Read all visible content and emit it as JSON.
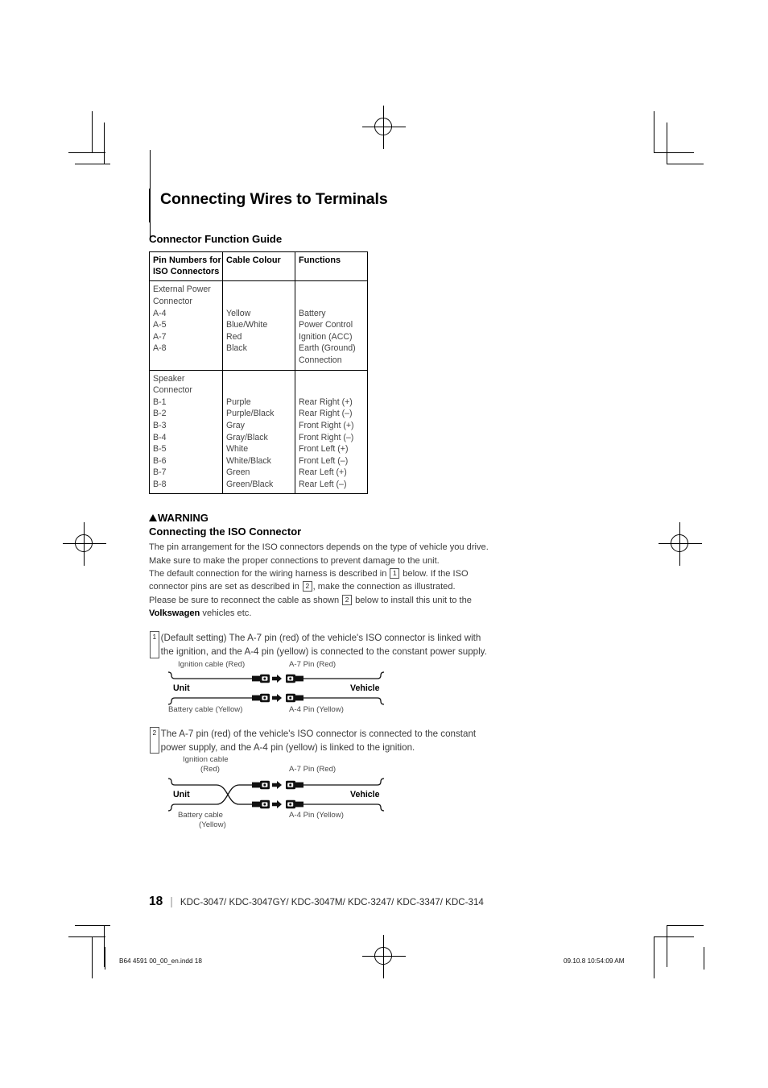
{
  "document": {
    "title": "Connecting Wires to Terminals",
    "section_title": "Connector Function Guide"
  },
  "table": {
    "headers": [
      "Pin Numbers for ISO Connectors",
      "Cable Colour",
      "Functions"
    ],
    "header_lines": [
      [
        "Pin Numbers for",
        "ISO Connectors"
      ],
      [
        "Cable Colour"
      ],
      [
        "Functions"
      ]
    ],
    "groups": [
      {
        "name": "External Power Connector",
        "pins_lines": [
          "External Power",
          "Connector",
          "A-4",
          "A-5",
          "A-7",
          "A-8"
        ],
        "colour_lines": [
          "",
          "",
          "Yellow",
          "Blue/White",
          "Red",
          "Black"
        ],
        "function_lines": [
          "",
          "",
          "Battery",
          "Power Control",
          "Ignition (ACC)",
          "Earth (Ground)",
          "Connection"
        ]
      },
      {
        "name": "Speaker Connector",
        "pins_lines": [
          "Speaker",
          "Connector",
          "B-1",
          "B-2",
          "B-3",
          "B-4",
          "B-5",
          "B-6",
          "B-7",
          "B-8"
        ],
        "colour_lines": [
          "",
          "",
          "Purple",
          "Purple/Black",
          "Gray",
          "Gray/Black",
          "White",
          "White/Black",
          "Green",
          "Green/Black"
        ],
        "function_lines": [
          "",
          "",
          "Rear Right (+)",
          "Rear Right (–)",
          "Front Right (+)",
          "Front Right (–)",
          "Front Left (+)",
          "Front Left (–)",
          "Rear Left (+)",
          "Rear Left (–)"
        ]
      }
    ]
  },
  "warning": {
    "label": "WARNING",
    "subtitle": "Connecting the ISO Connector",
    "paragraph1_part1": "The pin arrangement for the ISO connectors depends on the type of vehicle you drive. Make sure to make the proper connections to prevent damage to the unit.",
    "paragraph2_a": "The default connection for the wiring harness is described in",
    "paragraph2_box1": "1",
    "paragraph2_b": "below. If the ISO connector pins are set as described in",
    "paragraph2_box2": "2",
    "paragraph2_c": ", make the connection as illustrated.",
    "paragraph3_a": "Please be sure to reconnect the cable as shown",
    "paragraph3_box": "2",
    "paragraph3_b": "below to install this unit to the",
    "paragraph3_brand": "Volkswagen",
    "paragraph3_c": "vehicles etc."
  },
  "steps": [
    {
      "number": "1",
      "text": "(Default setting) The A-7 pin (red) of the vehicle's ISO connector is linked with the ignition, and the A-4 pin (yellow) is connected to the constant power supply.",
      "diagram": {
        "crossed": false,
        "top_left_label": "Ignition cable (Red)",
        "top_right_label": "A-7 Pin (Red)",
        "bottom_left_label": "Battery cable (Yellow)",
        "bottom_right_label": "A-4 Pin (Yellow)",
        "unit_label": "Unit",
        "vehicle_label": "Vehicle"
      }
    },
    {
      "number": "2",
      "text": "The A-7 pin (red) of the vehicle's ISO connector is connected to the constant power supply, and the A-4 pin (yellow) is linked to the ignition.",
      "diagram": {
        "crossed": true,
        "top_left_label_line1": "Ignition cable",
        "top_left_label_line2": "(Red)",
        "top_right_label": "A-7 Pin (Red)",
        "bottom_left_label_line1": "Battery cable",
        "bottom_left_label_line2": "(Yellow)",
        "bottom_right_label": "A-4 Pin (Yellow)",
        "unit_label": "Unit",
        "vehicle_label": "Vehicle"
      }
    }
  ],
  "footer": {
    "page_number": "18",
    "separator": "|",
    "models": "KDC-3047/ KDC-3047GY/ KDC-3047M/ KDC-3247/ KDC-3347/ KDC-314"
  },
  "print_info": {
    "file": "B64 4591 00_00_en.indd   18",
    "timestamp": "09.10.8   10:54:09 AM"
  }
}
